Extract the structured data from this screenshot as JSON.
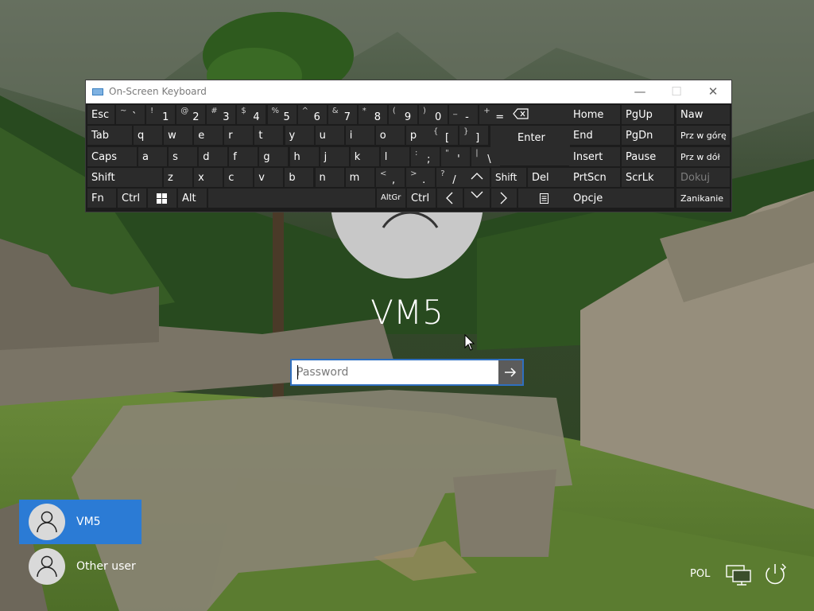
{
  "osk": {
    "title": "On-Screen Keyboard",
    "controls": {
      "minimize": "—",
      "maximize": "☐",
      "close": "✕"
    },
    "keys": {
      "esc": "Esc",
      "tab": "Tab",
      "caps": "Caps",
      "shift_left": "Shift",
      "fn": "Fn",
      "ctrl_left": "Ctrl",
      "alt": "Alt",
      "altgr": "AltGr",
      "ctrl_right": "Ctrl",
      "enter": "Enter",
      "shift_right": "Shift",
      "del": "Del",
      "row1": [
        {
          "shift": "~",
          "main": "`"
        },
        {
          "shift": "!",
          "main": "1"
        },
        {
          "shift": "@",
          "main": "2"
        },
        {
          "shift": "#",
          "main": "3"
        },
        {
          "shift": "$",
          "main": "4"
        },
        {
          "shift": "%",
          "main": "5"
        },
        {
          "shift": "^",
          "main": "6"
        },
        {
          "shift": "&",
          "main": "7"
        },
        {
          "shift": "*",
          "main": "8"
        },
        {
          "shift": "(",
          "main": "9"
        },
        {
          "shift": ")",
          "main": "0"
        },
        {
          "shift": "_",
          "main": "-"
        },
        {
          "shift": "+",
          "main": "="
        }
      ],
      "row2": [
        "q",
        "w",
        "e",
        "r",
        "t",
        "y",
        "u",
        "i",
        "o",
        "p"
      ],
      "row2_brackets": [
        {
          "shift": "{",
          "main": "["
        },
        {
          "shift": "}",
          "main": "]"
        }
      ],
      "row3": [
        "a",
        "s",
        "d",
        "f",
        "g",
        "h",
        "j",
        "k",
        "l"
      ],
      "row3_punct": [
        {
          "shift": ":",
          "main": ";"
        },
        {
          "shift": "\"",
          "main": "'"
        },
        {
          "shift": "|",
          "main": "\\"
        }
      ],
      "row4": [
        "z",
        "x",
        "c",
        "v",
        "b",
        "n",
        "m"
      ],
      "row4_punct": [
        {
          "shift": "<",
          "main": ","
        },
        {
          "shift": ">",
          "main": "."
        },
        {
          "shift": "?",
          "main": "/"
        }
      ],
      "nav": {
        "home": "Home",
        "pgup": "PgUp",
        "naw": "Naw",
        "end": "End",
        "pgdn": "PgDn",
        "przwgore": "Prz w górę",
        "insert": "Insert",
        "pause": "Pause",
        "przwdol": "Prz w dół",
        "prtscn": "PrtScn",
        "scrlk": "ScrLk",
        "dokuj": "Dokuj",
        "opcje": "Opcje",
        "zanikanie": "Zanikanie"
      }
    }
  },
  "login": {
    "username": "VM5",
    "password_placeholder": "Password"
  },
  "users": [
    {
      "name": "VM5",
      "selected": true
    },
    {
      "name": "Other user",
      "selected": false
    }
  ],
  "status": {
    "language": "POL"
  },
  "colors": {
    "accent": "#2b7bd5",
    "keyboard_bg": "#1c1c1c",
    "key_bg": "#2b2b2b"
  },
  "icons": [
    "keyboard-icon",
    "backspace-icon",
    "windows-icon",
    "arrow-up-icon",
    "arrow-down-icon",
    "arrow-left-icon",
    "arrow-right-icon",
    "menu-icon",
    "user-icon",
    "arrow-right-submit-icon",
    "network-icon",
    "power-icon"
  ]
}
